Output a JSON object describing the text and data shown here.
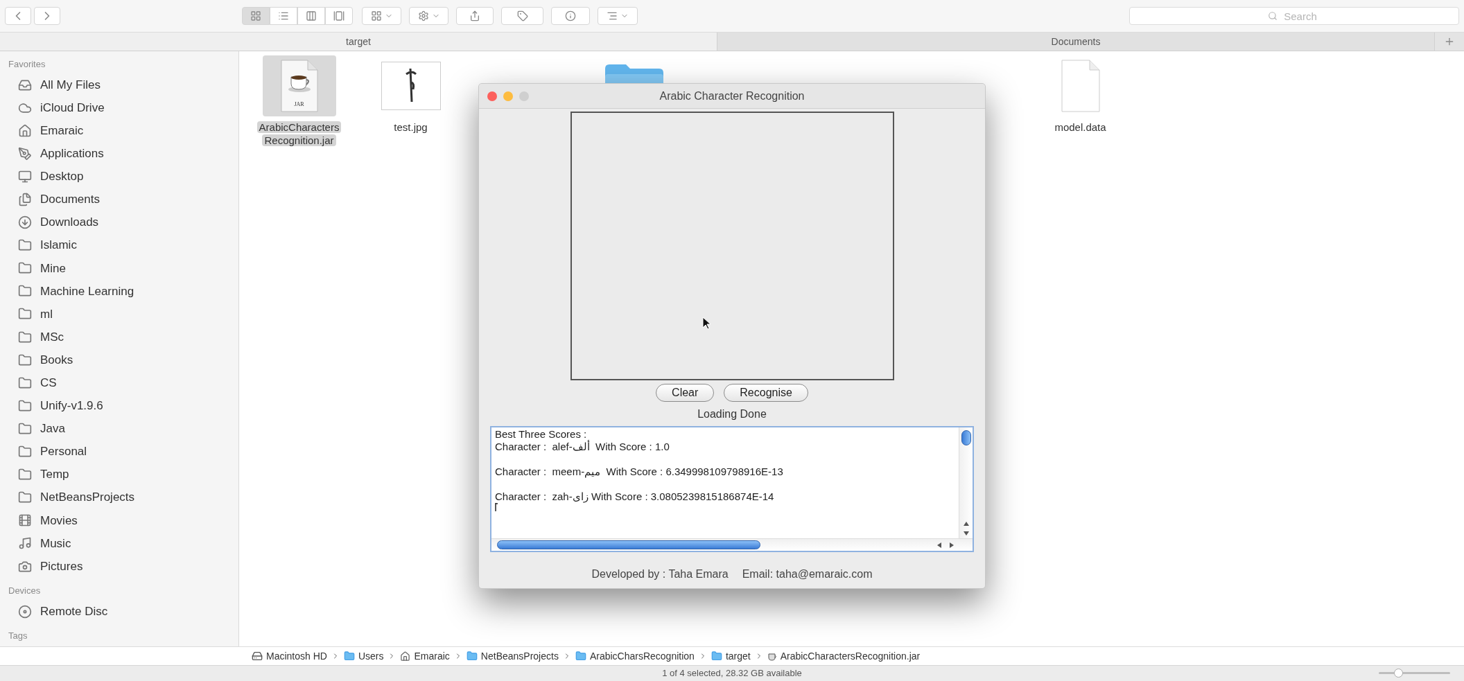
{
  "toolbar": {
    "view_modes": [
      {
        "kind": "icons",
        "selected": true
      },
      {
        "kind": "list",
        "selected": false
      },
      {
        "kind": "columns",
        "selected": false
      },
      {
        "kind": "gallery",
        "selected": false
      }
    ],
    "search": {
      "placeholder": "Search"
    }
  },
  "tabs": [
    {
      "label": "target",
      "selected": true
    },
    {
      "label": "Documents",
      "selected": false
    }
  ],
  "sidebar": {
    "sections": [
      {
        "heading": "Favorites",
        "items": [
          {
            "label": "All My Files",
            "kind": "files"
          },
          {
            "label": "iCloud Drive",
            "kind": "cloud"
          },
          {
            "label": "Emaraic",
            "kind": "home"
          },
          {
            "label": "Applications",
            "kind": "applications"
          },
          {
            "label": "Desktop",
            "kind": "desktop"
          },
          {
            "label": "Documents",
            "kind": "documents"
          },
          {
            "label": "Downloads",
            "kind": "downloads"
          },
          {
            "label": "Islamic",
            "kind": "folder"
          },
          {
            "label": "Mine",
            "kind": "folder"
          },
          {
            "label": "Machine Learning",
            "kind": "folder"
          },
          {
            "label": "ml",
            "kind": "folder"
          },
          {
            "label": "MSc",
            "kind": "folder"
          },
          {
            "label": "Books",
            "kind": "folder"
          },
          {
            "label": "CS",
            "kind": "folder"
          },
          {
            "label": "Unify-v1.9.6",
            "kind": "folder"
          },
          {
            "label": "Java",
            "kind": "folder"
          },
          {
            "label": "Personal",
            "kind": "folder"
          },
          {
            "label": "Temp",
            "kind": "folder"
          },
          {
            "label": "NetBeansProjects",
            "kind": "folder"
          },
          {
            "label": "Movies",
            "kind": "movies"
          },
          {
            "label": "Music",
            "kind": "music"
          },
          {
            "label": "Pictures",
            "kind": "pictures"
          }
        ]
      },
      {
        "heading": "Devices",
        "items": [
          {
            "label": "Remote Disc",
            "kind": "disc"
          }
        ]
      },
      {
        "heading": "Tags"
      }
    ]
  },
  "files": [
    {
      "name_lines": [
        "ArabicCharacters",
        "Recognition.jar"
      ],
      "kind": "jar",
      "badge": "JAR",
      "selected": true
    },
    {
      "name_lines": [
        "test.jpg"
      ],
      "selected": false
    },
    {
      "kind": "folder",
      "selected": false
    },
    {
      "name_lines": [
        "model.data"
      ],
      "kind": "document",
      "selected": false
    }
  ],
  "dialog": {
    "title": "Arabic Character Recognition",
    "controls": [
      {
        "kind": "close",
        "disabled": false
      },
      {
        "kind": "minimize",
        "disabled": false
      },
      {
        "kind": "zoom",
        "disabled": true
      }
    ],
    "buttons": [
      "Clear",
      "Recognise"
    ],
    "status": "Loading Done",
    "output": {
      "heading": "Best Three Scores :",
      "results": [
        "Character :  alef-ألف  With Score : 1.0",
        "Character :  meem-ميم  With Score : 6.349998109798916E-13",
        "Character :  zah-زاى With Score : 3.0805239815186874E-14"
      ]
    },
    "footer": [
      "Developed by : Taha Emara",
      "Email: taha@emaraic.com"
    ]
  },
  "path_bar": [
    {
      "label": "Macintosh HD",
      "kind": "disk"
    },
    {
      "label": "Users",
      "kind": "folder"
    },
    {
      "label": "Emaraic",
      "kind": "home"
    },
    {
      "label": "NetBeansProjects",
      "kind": "folder"
    },
    {
      "label": "ArabicCharsRecognition",
      "kind": "folder"
    },
    {
      "label": "target",
      "kind": "folder"
    },
    {
      "label": "ArabicCharactersRecognition.jar",
      "kind": "jar"
    }
  ],
  "status_bar": {
    "text": "1 of 4 selected, 28.32 GB available",
    "zoom": {
      "level": 0.27
    }
  }
}
